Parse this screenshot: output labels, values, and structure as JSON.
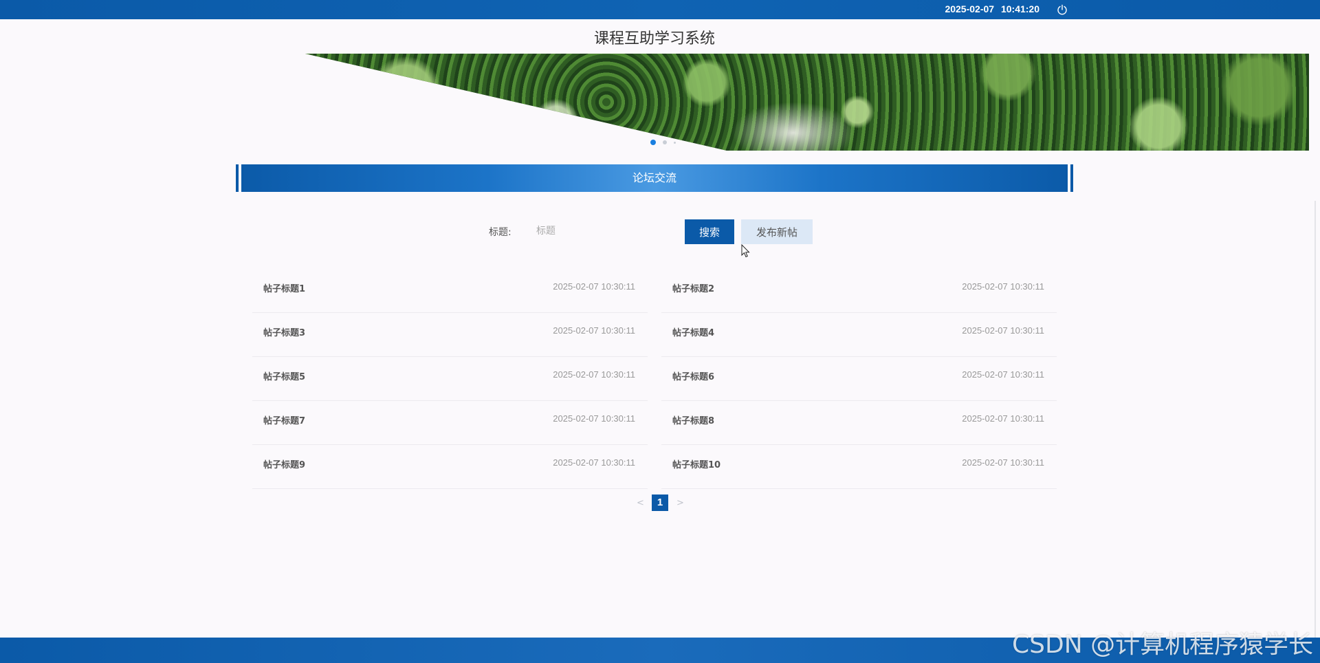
{
  "topbar": {
    "date": "2025-02-07",
    "time": "10:41:20",
    "logout_icon": "power-icon"
  },
  "site": {
    "title": "课程互助学习系统"
  },
  "banner": {
    "slides": 3,
    "active_slide": 1
  },
  "section": {
    "title": "论坛交流"
  },
  "search": {
    "label": "标题:",
    "placeholder": "标题",
    "value": "",
    "search_button": "搜索",
    "new_post_button": "发布新帖"
  },
  "posts": [
    {
      "title": "帖子标题1",
      "time": "2025-02-07 10:30:11"
    },
    {
      "title": "帖子标题2",
      "time": "2025-02-07 10:30:11"
    },
    {
      "title": "帖子标题3",
      "time": "2025-02-07 10:30:11"
    },
    {
      "title": "帖子标题4",
      "time": "2025-02-07 10:30:11"
    },
    {
      "title": "帖子标题5",
      "time": "2025-02-07 10:30:11"
    },
    {
      "title": "帖子标题6",
      "time": "2025-02-07 10:30:11"
    },
    {
      "title": "帖子标题7",
      "time": "2025-02-07 10:30:11"
    },
    {
      "title": "帖子标题8",
      "time": "2025-02-07 10:30:11"
    },
    {
      "title": "帖子标题9",
      "time": "2025-02-07 10:30:11"
    },
    {
      "title": "帖子标题10",
      "time": "2025-02-07 10:30:11"
    }
  ],
  "pagination": {
    "prev": "<",
    "current": "1",
    "next": ">"
  },
  "watermark": "CSDN @计算机程序猿学长",
  "colors": {
    "primary": "#0b5aa8",
    "secondary_button": "#dce8f6",
    "page_bg": "#fbf9fc"
  }
}
